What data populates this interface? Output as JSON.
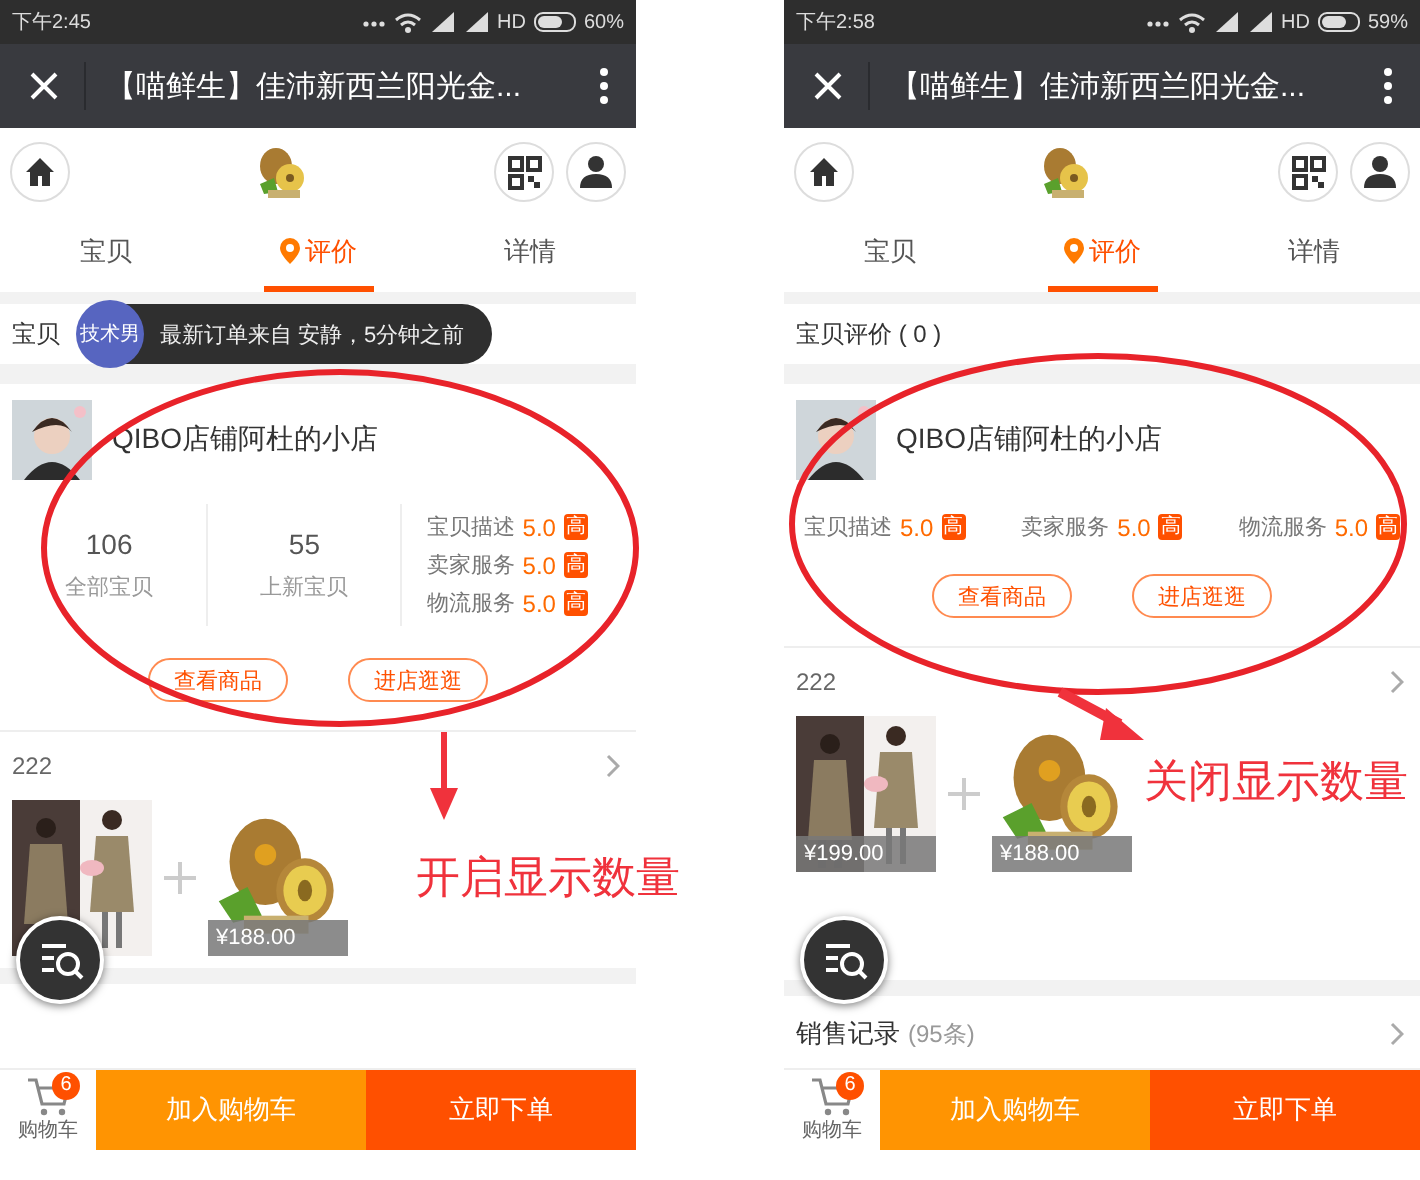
{
  "panels": [
    {
      "status_bar": {
        "time": "下午2:45",
        "network": "HD",
        "battery": "60%"
      },
      "title": "【喵鲜生】佳沛新西兰阳光金...",
      "tabs": [
        {
          "label": "宝贝",
          "selected": false
        },
        {
          "label": "评价",
          "selected": true
        },
        {
          "label": "详情",
          "selected": false
        }
      ],
      "review_title": "宝贝",
      "toast": {
        "badge": "技术男",
        "text": "最新订单来自 安静，5分钟之前"
      },
      "shop": {
        "name": "QIBO店铺阿杜的小店",
        "counts": [
          {
            "value": "106",
            "label": "全部宝贝"
          },
          {
            "value": "55",
            "label": "上新宝贝"
          }
        ],
        "ratings": [
          {
            "label": "宝贝描述",
            "score": "5.0",
            "tag": "高"
          },
          {
            "label": "卖家服务",
            "score": "5.0",
            "tag": "高"
          },
          {
            "label": "物流服务",
            "score": "5.0",
            "tag": "高"
          }
        ],
        "buttons": [
          "查看商品",
          "进店逛逛"
        ]
      },
      "bundle": {
        "title": "222",
        "items": [
          {
            "kind": "coat"
          },
          {
            "kind": "kiwi",
            "price": "¥188.00"
          }
        ]
      },
      "cart": {
        "label": "购物车",
        "count": "6"
      },
      "actions": [
        "加入购物车",
        "立即下单"
      ],
      "annotation": {
        "caption": "开启显示数量"
      }
    },
    {
      "status_bar": {
        "time": "下午2:58",
        "network": "HD",
        "battery": "59%"
      },
      "title": "【喵鲜生】佳沛新西兰阳光金...",
      "tabs": [
        {
          "label": "宝贝",
          "selected": false
        },
        {
          "label": "评价",
          "selected": true
        },
        {
          "label": "详情",
          "selected": false
        }
      ],
      "review_title": "宝贝评价 ( 0 )",
      "shop": {
        "name": "QIBO店铺阿杜的小店",
        "ratings": [
          {
            "label": "宝贝描述",
            "score": "5.0",
            "tag": "高"
          },
          {
            "label": "卖家服务",
            "score": "5.0",
            "tag": "高"
          },
          {
            "label": "物流服务",
            "score": "5.0",
            "tag": "高"
          }
        ],
        "buttons": [
          "查看商品",
          "进店逛逛"
        ]
      },
      "bundle": {
        "title": "222",
        "items": [
          {
            "kind": "coat",
            "price": "¥199.00"
          },
          {
            "kind": "kiwi",
            "price": "¥188.00"
          }
        ]
      },
      "sales": {
        "label": "销售记录",
        "count": "(95条)"
      },
      "cart": {
        "label": "购物车",
        "count": "6"
      },
      "actions": [
        "加入购物车",
        "立即下单"
      ],
      "annotation": {
        "caption": "关闭显示数量"
      }
    }
  ]
}
